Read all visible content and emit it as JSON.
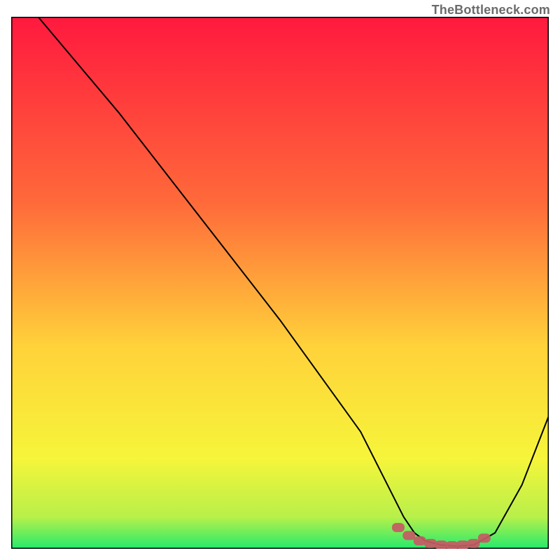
{
  "watermark": "TheBottleneck.com",
  "chart_data": {
    "type": "line",
    "title": "",
    "xlabel": "",
    "ylabel": "",
    "xlim": [
      0,
      100
    ],
    "ylim": [
      0,
      100
    ],
    "grid": false,
    "legend": false,
    "background_gradient": {
      "top": "#ff193e",
      "two_thirds": "#ffe23a",
      "bottom": "#24ea6c"
    },
    "series": [
      {
        "name": "curve",
        "color": "#000000",
        "x": [
          5,
          10,
          20,
          30,
          40,
          50,
          60,
          65,
          70,
          73,
          75,
          77,
          80,
          83,
          86,
          90,
          95,
          100
        ],
        "y": [
          100,
          94,
          82,
          69,
          56,
          43,
          29,
          22,
          12,
          6,
          3,
          1.5,
          0.7,
          0.5,
          0.7,
          3,
          12,
          25
        ]
      },
      {
        "name": "valley-marker",
        "color": "#c55a64",
        "style": "thick-scatter-band",
        "x": [
          72,
          74,
          76,
          78,
          80,
          82,
          84,
          86,
          88
        ],
        "y": [
          4,
          2.5,
          1.5,
          1,
          0.7,
          0.6,
          0.7,
          1,
          2
        ]
      }
    ]
  }
}
